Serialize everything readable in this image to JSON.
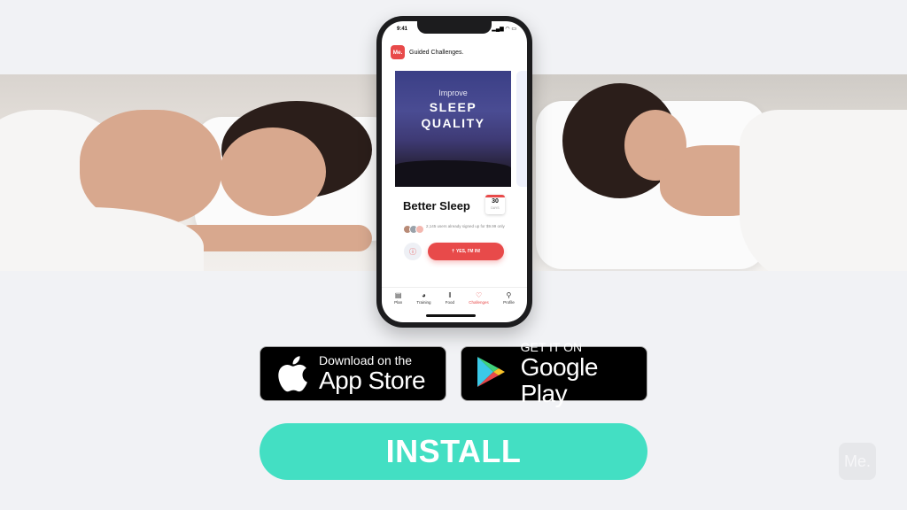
{
  "phone": {
    "status_time": "9:41",
    "status_icons": "▂▄▆ ◠ ▭",
    "app_logo": "Me.",
    "app_title": "Guided Challenges.",
    "hero": {
      "line_small": "Improve",
      "line_big_1": "SLEEP",
      "line_big_2": "QUALITY"
    },
    "challenge_title": "Better Sleep",
    "days_badge": {
      "number": "30",
      "unit": "DAYS"
    },
    "signup_text": "2,145 users already signed up for $9.99 only",
    "info_icon": "ⓘ",
    "cta_label": "⇡ YES, I'M IN!",
    "tabs": [
      {
        "label": "Plan",
        "icon": "▤"
      },
      {
        "label": "Training",
        "icon": "◕"
      },
      {
        "label": "Food",
        "icon": "ǁ"
      },
      {
        "label": "Challenges",
        "icon": "♡"
      },
      {
        "label": "Profile",
        "icon": "⚲"
      }
    ],
    "active_tab": "Challenges"
  },
  "stores": {
    "appstore": {
      "small": "Download on the",
      "large": "App Store"
    },
    "googleplay": {
      "small": "GET IT ON",
      "large": "Google Play"
    }
  },
  "install_label": "INSTALL",
  "watermark_logo": "Me.",
  "colors": {
    "brand_red": "#e84a4a",
    "install_teal": "#43dfc3",
    "background": "#f1f2f5"
  }
}
